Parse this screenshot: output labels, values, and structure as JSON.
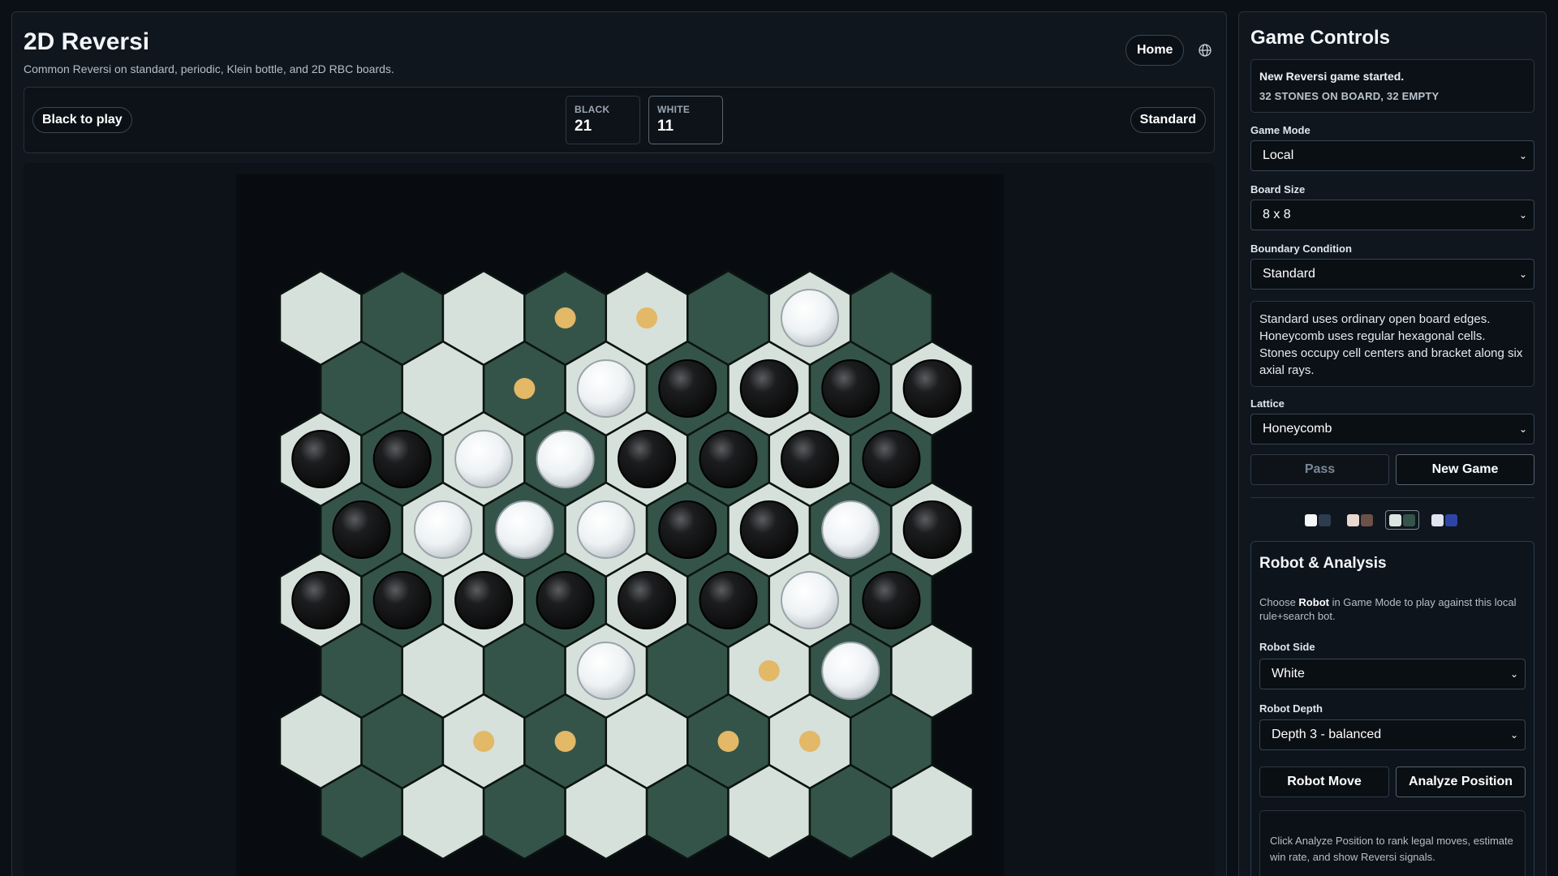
{
  "header": {
    "title": "2D Reversi",
    "subtitle": "Common Reversi on standard, periodic, Klein bottle, and 2D RBC boards.",
    "home_label": "Home",
    "language_icon": "globe-icon"
  },
  "status": {
    "turn_label": "Black to play",
    "black_label": "BLACK",
    "black_score": "21",
    "white_label": "WHITE",
    "white_score": "11",
    "mode_label": "Standard"
  },
  "board": {
    "rows": 8,
    "cols": 8,
    "cells": [
      "LDLD..LD",
      "DLDLDLDL",
      "LDLDLDLD",
      "DLDLDLDL",
      "LDLDLDLD",
      "DLDLDLDL",
      "LDLDLDLD",
      "DLDLDLDL"
    ],
    "stones": [
      "......W.",
      "....WBBBB",
      "BBWWBBBB",
      "BWWWBBWB",
      "BBBBBBWB",
      "....W.W.",
      "........",
      "........"
    ],
    "stone_grid": [
      [
        ".",
        ".",
        ".",
        ".",
        ".",
        ".",
        "W",
        "."
      ],
      [
        ".",
        ".",
        ".",
        "W",
        "B",
        "B",
        "B",
        "B"
      ],
      [
        "B",
        "B",
        "W",
        "W",
        "B",
        "B",
        "B",
        "B"
      ],
      [
        "B",
        "W",
        "W",
        "W",
        "B",
        "B",
        "W",
        "B"
      ],
      [
        "B",
        "B",
        "B",
        "B",
        "B",
        "B",
        "W",
        "B"
      ],
      [
        ".",
        ".",
        ".",
        "W",
        ".",
        ".",
        "W",
        "."
      ],
      [
        ".",
        ".",
        ".",
        ".",
        ".",
        ".",
        ".",
        "."
      ],
      [
        ".",
        ".",
        ".",
        ".",
        ".",
        ".",
        ".",
        "."
      ]
    ],
    "hints": [
      [
        0,
        3
      ],
      [
        0,
        4
      ],
      [
        1,
        2
      ],
      [
        5,
        5
      ],
      [
        6,
        2
      ],
      [
        6,
        3
      ],
      [
        6,
        5
      ],
      [
        6,
        6
      ]
    ],
    "colors": {
      "light_cell": "#d6e1dc",
      "dark_cell": "#34544a",
      "black_stone": "#0a0a0a",
      "white_stone": "#eef2f4",
      "hint": "#e3b866"
    }
  },
  "controls": {
    "title": "Game Controls",
    "message_line1": "New Reversi game started.",
    "message_line2": "32 STONES ON BOARD, 32 EMPTY",
    "game_mode_label": "Game Mode",
    "game_mode_value": "Local",
    "board_size_label": "Board Size",
    "board_size_value": "8 x 8",
    "boundary_label": "Boundary Condition",
    "boundary_value": "Standard",
    "description": "Standard uses ordinary open board edges. Honeycomb uses regular hexagonal cells. Stones occupy cell centers and bracket along six axial rays.",
    "lattice_label": "Lattice",
    "lattice_value": "Honeycomb",
    "pass_label": "Pass",
    "new_game_label": "New Game",
    "themes": [
      {
        "a": "#f4f6f8",
        "b": "#2c3d4f"
      },
      {
        "a": "#e9d8cf",
        "b": "#6b5148"
      },
      {
        "a": "#dce6e1",
        "b": "#34544a"
      },
      {
        "a": "#dfe4f0",
        "b": "#2f45a6"
      }
    ]
  },
  "robot": {
    "title": "Robot & Analysis",
    "note_pre": "Choose ",
    "note_bold": "Robot",
    "note_post": " in Game Mode to play against this local rule+search bot.",
    "side_label": "Robot Side",
    "side_value": "White",
    "depth_label": "Robot Depth",
    "depth_value": "Depth 3 - balanced",
    "move_label": "Robot Move",
    "analyze_label": "Analyze Position",
    "analysis_text": "Click Analyze Position to rank legal moves, estimate win rate, and show Reversi signals."
  }
}
